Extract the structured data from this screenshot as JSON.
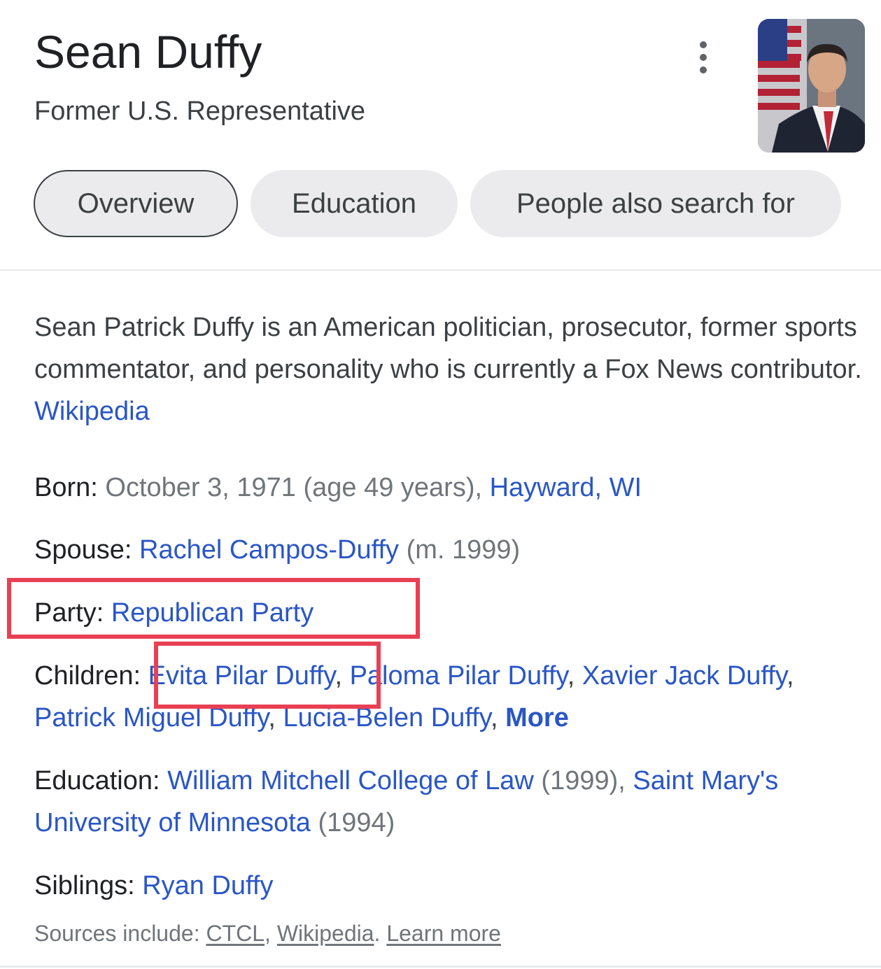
{
  "header": {
    "title": "Sean Duffy",
    "subtitle": "Former U.S. Representative"
  },
  "tabs": [
    {
      "label": "Overview",
      "active": true
    },
    {
      "label": "Education",
      "active": false
    },
    {
      "label": "People also search for",
      "active": false
    }
  ],
  "description": {
    "text": "Sean Patrick Duffy is an American politician, prosecutor, former sports commentator, and personality who is currently a Fox News contributor. ",
    "source_link": "Wikipedia"
  },
  "facts": {
    "born": {
      "label": "Born:",
      "date": " October 3, 1971 (age 49 years), ",
      "place": "Hayward, WI"
    },
    "spouse": {
      "label": "Spouse:",
      "name": "Rachel Campos-Duffy",
      "note": " (m. 1999)"
    },
    "party": {
      "label": "Party:",
      "value": "Republican Party"
    },
    "children": {
      "label": "Children:",
      "names": [
        "Evita Pilar Duffy",
        "Paloma Pilar Duffy",
        "Xavier Jack Duffy",
        "Patrick Miguel Duffy",
        "Lucia-Belen Duffy"
      ],
      "more": "More"
    },
    "education": {
      "label": "Education:",
      "school1": "William Mitchell College of Law",
      "year1": " (1999), ",
      "school2": "Saint Mary's University of Minnesota",
      "year2": " (1994)"
    },
    "siblings": {
      "label": "Siblings:",
      "value": "Ryan Duffy"
    }
  },
  "sources": {
    "prefix": "Sources include: ",
    "links": [
      "CTCL",
      "Wikipedia"
    ],
    "learn_more": "Learn more"
  },
  "colors": {
    "link": "#2a56c6",
    "highlight": "#e84052"
  },
  "icons": {
    "menu": "more-vert-icon"
  }
}
